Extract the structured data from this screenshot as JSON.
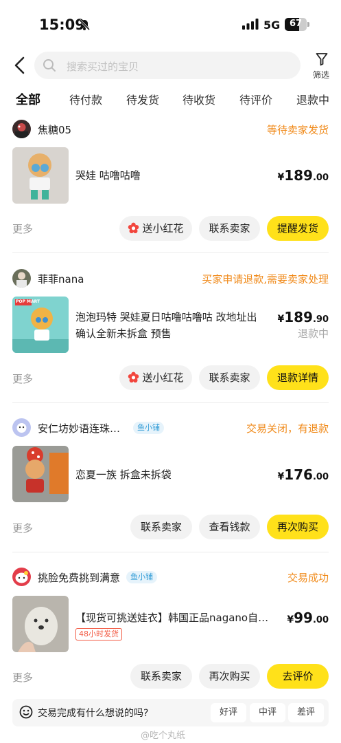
{
  "status_bar": {
    "time": "15:09",
    "network": "5G",
    "battery": "67",
    "battery_level": 0.67
  },
  "header": {
    "search_placeholder": "搜索买过的宝贝",
    "filter_label": "筛选"
  },
  "tabs": [
    {
      "label": "全部",
      "active": true
    },
    {
      "label": "待付款"
    },
    {
      "label": "待发货"
    },
    {
      "label": "待收货"
    },
    {
      "label": "待评价"
    },
    {
      "label": "退款中"
    }
  ],
  "orders": [
    {
      "seller": "焦糖05",
      "status": "等待卖家发货",
      "title": "哭娃 咕噜咕噜",
      "price_symbol": "¥",
      "price_int": "189",
      "price_dec": ".00",
      "more": "更多",
      "buttons": [
        "送小红花",
        "联系卖家",
        "提醒发货"
      ]
    },
    {
      "seller": "菲菲nana",
      "status": "买家申请退款,需要卖家处理",
      "title_line1": "泡泡玛特 哭娃夏日咕噜咕噜咕 改地址出",
      "title_line2": "确认全新未拆盒 预售",
      "thumb_text": "POP MART",
      "price_symbol": "¥",
      "price_int": "189",
      "price_dec": ".90",
      "refund_note": "退款中",
      "more": "更多",
      "buttons": [
        "送小红花",
        "联系卖家",
        "退款详情"
      ]
    },
    {
      "seller": "安仁坊妙语连珠…",
      "badge": "鱼小铺",
      "status": "交易关闭，有退款",
      "title": "恋夏一族 拆盒未拆袋",
      "price_symbol": "¥",
      "price_int": "176",
      "price_dec": ".00",
      "more": "更多",
      "buttons": [
        "联系卖家",
        "查看钱款",
        "再次购买"
      ]
    },
    {
      "seller": "挑脸免费挑到满意",
      "badge": "鱼小铺",
      "status": "交易成功",
      "title": "【现货可挑送娃衣】韩国正品nagano自…",
      "ship_tag": "48小时发货",
      "price_symbol": "¥",
      "price_int": "99",
      "price_dec": ".00",
      "more": "更多",
      "buttons": [
        "联系卖家",
        "再次购买",
        "去评价"
      ]
    }
  ],
  "feedback": {
    "question": "交易完成有什么想说的吗?",
    "options": [
      "好评",
      "中评",
      "差评"
    ]
  },
  "watermark": "@吃个丸纸",
  "colors": {
    "accent": "#ffe11a",
    "status_orange": "#f08a1a",
    "badge_blue": "#3aa0d8"
  }
}
